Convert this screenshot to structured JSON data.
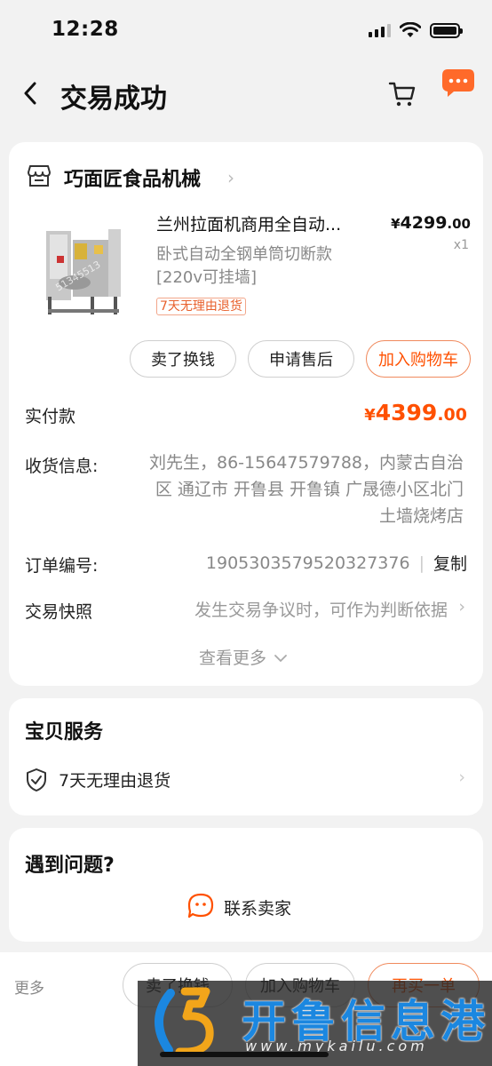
{
  "status": {
    "time": "12:28"
  },
  "nav": {
    "title": "交易成功",
    "back_icon": "chevron-left-icon",
    "cart_icon": "cart-icon",
    "message_icon": "message-icon"
  },
  "shop": {
    "name": "巧面匠食品机械",
    "icon": "store-icon"
  },
  "product": {
    "title": "兰州拉面机商用全自动...",
    "price_currency": "¥",
    "price_int": "4299",
    "price_dec": ".00",
    "quantity": "x1",
    "sku": "卧式自动全钢单筒切断款[220v可挂墙]",
    "tag": "7天无理由退货",
    "image_watermark": "51345513"
  },
  "actions": {
    "sell": "卖了换钱",
    "after_sale": "申请售后",
    "add_cart": "加入购物车"
  },
  "payment": {
    "label": "实付款",
    "currency": "¥",
    "amount_int": "4399",
    "amount_dec": ".00"
  },
  "shipping": {
    "label": "收货信息:",
    "address": "刘先生，86-15647579788，内蒙古自治区 通辽市 开鲁县 开鲁镇 广晟德小区北门土墙烧烤店"
  },
  "order": {
    "label": "订单编号:",
    "number": "1905303579520327376",
    "separator": "|",
    "copy": "复制"
  },
  "snapshot": {
    "label": "交易快照",
    "text": "发生交易争议时，可作为判断依据",
    "arrow": "›"
  },
  "more": {
    "label": "查看更多"
  },
  "service": {
    "title": "宝贝服务",
    "item": "7天无理由退货",
    "icon": "shield-check-icon",
    "arrow": "›"
  },
  "help": {
    "title": "遇到问题?",
    "contact": "联系卖家",
    "icon": "chat-icon"
  },
  "bottom": {
    "more": "更多",
    "sell": "卖了换钱",
    "add_cart": "加入购物车",
    "rebuy": "再买一单"
  },
  "watermark": {
    "name": "开鲁信息港",
    "url": "www.mykailu.com"
  },
  "colors": {
    "accent": "#ff5000",
    "tag_border": "#f2a68a",
    "watermark_blue": "#1b87e0"
  }
}
